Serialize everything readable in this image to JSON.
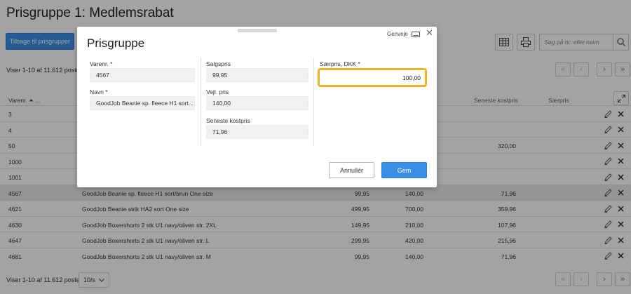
{
  "page": {
    "title": "Prisgruppe 1: Medlemsrabat",
    "back_button": "Tilbage til prisgrupper",
    "search_placeholder": "Søg på nr. eller navn",
    "range_text": "Viser 1-10 af 11.612 poster",
    "per_page": "10/s"
  },
  "table": {
    "headers": {
      "varenr": "Varenr. ⏶ ...",
      "seneste_kostpris": "Seneste kostpris",
      "saerpris": "Særpris"
    },
    "rows": [
      {
        "varenr": "3",
        "navn": "",
        "salgspris": "",
        "vejl_pris": "",
        "kostpris": "",
        "selected": false
      },
      {
        "varenr": "4",
        "navn": "",
        "salgspris": "",
        "vejl_pris": "",
        "kostpris": "",
        "selected": false
      },
      {
        "varenr": "50",
        "navn": "",
        "salgspris": "",
        "vejl_pris": "",
        "kostpris": "320,00",
        "selected": false
      },
      {
        "varenr": "1000",
        "navn": "",
        "salgspris": "",
        "vejl_pris": "",
        "kostpris": "",
        "selected": false
      },
      {
        "varenr": "1001",
        "navn": "",
        "salgspris": "",
        "vejl_pris": "",
        "kostpris": "",
        "selected": false
      },
      {
        "varenr": "4567",
        "navn": "GoodJob Beanie sp. fleece H1 sort/brun One size",
        "salgspris": "99,95",
        "vejl_pris": "140,00",
        "kostpris": "71,96",
        "selected": true
      },
      {
        "varenr": "4621",
        "navn": "GoodJob Beanie strik HA2 sort One size",
        "salgspris": "499,95",
        "vejl_pris": "700,00",
        "kostpris": "359,96",
        "selected": false
      },
      {
        "varenr": "4630",
        "navn": "GoodJob Boxershorts 2 stk U1 navy/oliven str. 2XL",
        "salgspris": "149,95",
        "vejl_pris": "210,00",
        "kostpris": "107,96",
        "selected": false
      },
      {
        "varenr": "4647",
        "navn": "GoodJob Boxershorts 2 stk U1 navy/oliven str. L",
        "salgspris": "299,95",
        "vejl_pris": "420,00",
        "kostpris": "215,96",
        "selected": false
      },
      {
        "varenr": "4681",
        "navn": "GoodJob Boxershorts 2 stk U1 navy/oliven str. M",
        "salgspris": "99,95",
        "vejl_pris": "140,00",
        "kostpris": "71,96",
        "selected": false
      }
    ]
  },
  "modal": {
    "title": "Prisgruppe",
    "shortcut": "Genveje",
    "varenr_label": "Varenr. *",
    "varenr_value": "4567",
    "navn_label": "Navn *",
    "navn_value": "GoodJob Beanie sp. fleece H1 sort...",
    "salgspris_label": "Salgspris",
    "salgspris_value": "99,95",
    "vejl_pris_label": "Vejl. pris",
    "vejl_pris_value": "140,00",
    "kostpris_label": "Seneste kostpris",
    "kostpris_value": "71,96",
    "saerpris_label": "Særpris, DKK *",
    "saerpris_value": "100,00",
    "cancel": "Annullér",
    "save": "Gem"
  },
  "colors": {
    "primary": "#3b8ee5",
    "highlight": "#f0b429",
    "overlay": "rgba(0,0,0,0.36)"
  }
}
